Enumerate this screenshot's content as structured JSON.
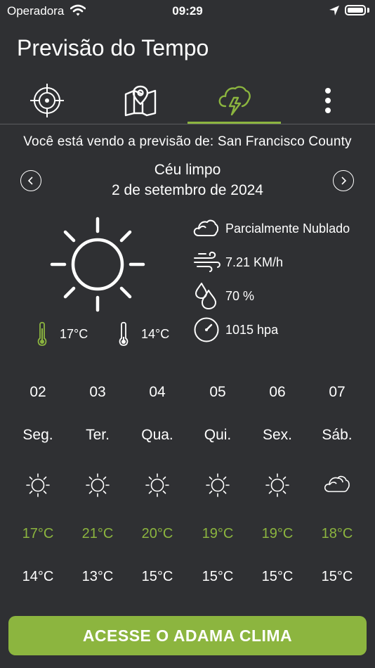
{
  "status_bar": {
    "carrier": "Operadora",
    "time": "09:29"
  },
  "header": {
    "title": "Previsão do Tempo"
  },
  "tabs": [
    {
      "icon": "target-icon"
    },
    {
      "icon": "map-icon"
    },
    {
      "icon": "storm-cloud-icon",
      "active": true
    },
    {
      "icon": "more-vertical-icon"
    }
  ],
  "location": {
    "text": "Você está vendo a previsão de: San Francisco County"
  },
  "current": {
    "condition": "Céu limpo",
    "date": "2 de setembro de 2024",
    "icon": "sun-icon",
    "temp_max": "17°C",
    "temp_min": "14°C",
    "details": {
      "sky": "Parcialmente Nublado",
      "wind": "7.21 KM/h",
      "humidity": "70 %",
      "pressure": "1015 hpa"
    }
  },
  "forecast": [
    {
      "day": "02",
      "weekday": "Seg.",
      "icon": "sun-icon",
      "max": "17°C",
      "min": "14°C"
    },
    {
      "day": "03",
      "weekday": "Ter.",
      "icon": "sun-icon",
      "max": "21°C",
      "min": "13°C"
    },
    {
      "day": "04",
      "weekday": "Qua.",
      "icon": "sun-icon",
      "max": "20°C",
      "min": "15°C"
    },
    {
      "day": "05",
      "weekday": "Qui.",
      "icon": "sun-icon",
      "max": "19°C",
      "min": "15°C"
    },
    {
      "day": "06",
      "weekday": "Sex.",
      "icon": "sun-icon",
      "max": "19°C",
      "min": "15°C"
    },
    {
      "day": "07",
      "weekday": "Sáb.",
      "icon": "cloud-icon",
      "max": "18°C",
      "min": "15°C"
    }
  ],
  "cta": {
    "label": "ACESSE O ADAMA CLIMA"
  },
  "colors": {
    "background": "#2f3033",
    "accent": "#8cb53f",
    "text": "#ffffff"
  }
}
